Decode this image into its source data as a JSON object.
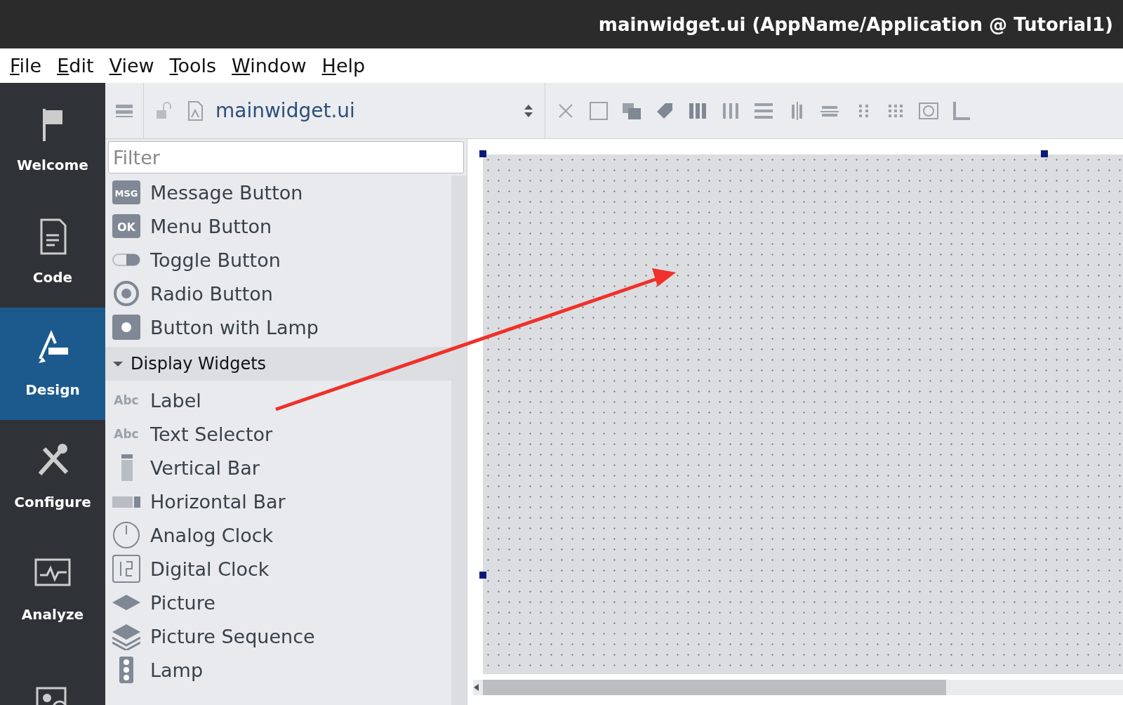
{
  "window": {
    "title": "mainwidget.ui (AppName/Application @ Tutorial1)"
  },
  "menu": [
    "File",
    "Edit",
    "View",
    "Tools",
    "Window",
    "Help"
  ],
  "modes": [
    {
      "label": "Welcome",
      "kind": "flag",
      "selected": false
    },
    {
      "label": "Code",
      "kind": "document",
      "selected": false
    },
    {
      "label": "Design",
      "kind": "design",
      "selected": true
    },
    {
      "label": "Configure",
      "kind": "tools",
      "selected": false
    },
    {
      "label": "Analyze",
      "kind": "monitor",
      "selected": false
    },
    {
      "kind": "debug",
      "selected": false
    }
  ],
  "toolbar": {
    "file": "mainwidget.ui"
  },
  "widget_box": {
    "filter": {
      "placeholder": "Filter"
    },
    "items": [
      {
        "label": "Message Button",
        "kind": "msg",
        "icon_text": "MSG"
      },
      {
        "label": "Menu Button",
        "kind": "ok",
        "icon_text": "OK"
      },
      {
        "label": "Toggle Button",
        "kind": "toggle"
      },
      {
        "label": "Radio Button",
        "kind": "radio"
      },
      {
        "label": "Button with Lamp",
        "kind": "lampbutton"
      },
      {
        "label": "Display Widgets",
        "kind": "category",
        "expanded": true
      },
      {
        "label": "Label",
        "kind": "abc",
        "icon_text": "Abc"
      },
      {
        "label": "Text Selector",
        "kind": "abc",
        "icon_text": "Abc"
      },
      {
        "label": "Vertical Bar",
        "kind": "vbar"
      },
      {
        "label": "Horizontal Bar",
        "kind": "hbar"
      },
      {
        "label": "Analog Clock",
        "kind": "analog"
      },
      {
        "label": "Digital Clock",
        "kind": "digital"
      },
      {
        "label": "Picture",
        "kind": "picture"
      },
      {
        "label": "Picture Sequence",
        "kind": "sequence"
      },
      {
        "label": "Lamp",
        "kind": "lamp"
      }
    ]
  }
}
